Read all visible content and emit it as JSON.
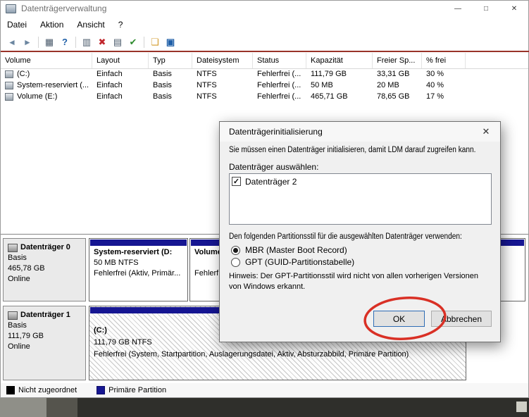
{
  "window": {
    "title": "Datenträgerverwaltung",
    "menu": [
      "Datei",
      "Aktion",
      "Ansicht",
      "?"
    ],
    "controls": {
      "minimize": "—",
      "maximize": "□",
      "close": "✕"
    }
  },
  "toolbar": {
    "icons": [
      {
        "name": "back",
        "glyph": "◄"
      },
      {
        "name": "forward",
        "glyph": "►"
      },
      {
        "name": "console-tree",
        "glyph": "▦"
      },
      {
        "name": "help",
        "glyph": "?"
      },
      {
        "name": "computer",
        "glyph": "▥"
      },
      {
        "name": "delete",
        "glyph": "✖"
      },
      {
        "name": "document",
        "glyph": "▤"
      },
      {
        "name": "check",
        "glyph": "✔"
      },
      {
        "name": "folder-up",
        "glyph": "❏"
      },
      {
        "name": "screen",
        "glyph": "▣"
      }
    ]
  },
  "table": {
    "columns": [
      "Volume",
      "Layout",
      "Typ",
      "Dateisystem",
      "Status",
      "Kapazität",
      "Freier Sp...",
      "% frei"
    ],
    "rows": [
      {
        "volume": "(C:)",
        "layout": "Einfach",
        "typ": "Basis",
        "fs": "NTFS",
        "status": "Fehlerfrei (...",
        "kap": "111,79 GB",
        "freier": "33,31 GB",
        "pct": "30 %"
      },
      {
        "volume": "System-reserviert (...",
        "layout": "Einfach",
        "typ": "Basis",
        "fs": "NTFS",
        "status": "Fehlerfrei (...",
        "kap": "50 MB",
        "freier": "20 MB",
        "pct": "40 %"
      },
      {
        "volume": "Volume (E:)",
        "layout": "Einfach",
        "typ": "Basis",
        "fs": "NTFS",
        "status": "Fehlerfrei (...",
        "kap": "465,71 GB",
        "freier": "78,65 GB",
        "pct": "17 %"
      }
    ]
  },
  "graph": {
    "disks": [
      {
        "name": "Datenträger 0",
        "type": "Basis",
        "size": "465,78 GB",
        "status": "Online",
        "partitions": [
          {
            "title": "System-reserviert (D:",
            "info": "50 MB NTFS",
            "status": "Fehlerfrei (Aktiv, Primär..."
          },
          {
            "title": "Volume...",
            "info": "",
            "status": "Fehlerf..."
          }
        ]
      },
      {
        "name": "Datenträger 1",
        "type": "Basis",
        "size": "111,79 GB",
        "status": "Online",
        "partitions": [
          {
            "title": "(C:)",
            "info": "111,79 GB NTFS",
            "status": "Fehlerfrei (System, Startpartition, Auslagerungsdatei, Aktiv, Absturzabbild, Primäre Partition)"
          }
        ]
      }
    ],
    "primary_partition_color": "#161692"
  },
  "legend": {
    "items": [
      {
        "label": "Nicht zugeordnet",
        "color": "#000000"
      },
      {
        "label": "Primäre Partition",
        "color": "#161692"
      }
    ]
  },
  "dialog": {
    "title": "Datenträgerinitialisierung",
    "close_glyph": "✕",
    "check_glyph": "✓",
    "intro": "Sie müssen einen Datenträger initialisieren, damit LDM darauf zugreifen kann.",
    "select_label": "Datenträger auswählen:",
    "disks": [
      {
        "label": "Datenträger 2",
        "checked": true
      }
    ],
    "style_label": "Den folgenden Partitionsstil für die ausgewählten Datenträger verwenden:",
    "options": [
      {
        "label": "MBR (Master Boot Record)",
        "selected": true
      },
      {
        "label": "GPT (GUID-Partitionstabelle)",
        "selected": false
      }
    ],
    "note": "Hinweis: Der GPT-Partitionsstil wird nicht von allen vorherigen Versionen von Windows erkannt.",
    "buttons": {
      "ok": "OK",
      "cancel": "Abbrechen"
    }
  },
  "annotation": {
    "color": "#d93025",
    "shape": "ellipse-around-ok-button"
  }
}
